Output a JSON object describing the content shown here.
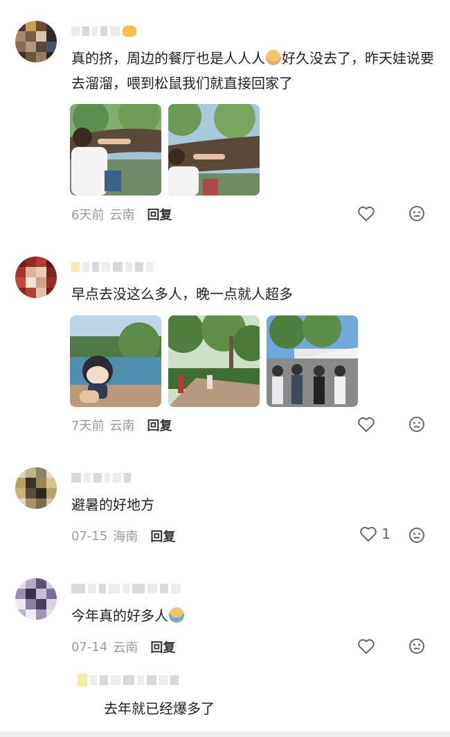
{
  "comments": [
    {
      "text": "真的挤，周边的餐厅也是人人人",
      "text2": "好久没去了，昨天娃说要去溜溜，喂到松鼠我们就直接回家了",
      "time": "6天前",
      "location": "云南",
      "reply": "回复",
      "likes": ""
    },
    {
      "text": "早点去没这么多人，晚一点就人超多",
      "time": "7天前",
      "location": "云南",
      "reply": "回复",
      "likes": ""
    },
    {
      "text": "避暑的好地方",
      "time": "07-15",
      "location": "海南",
      "reply": "回复",
      "likes": "1"
    },
    {
      "text": "今年真的好多人",
      "time": "07-14",
      "location": "云南",
      "reply": "回复",
      "likes": ""
    }
  ],
  "sub_reply": {
    "text": "去年就已经爆多了"
  },
  "icons": {
    "like": "heart-outline-icon",
    "dislike": "neutral-face-icon",
    "emoji1": "cute-face-emoji",
    "emoji2": "sweating-face-emoji"
  },
  "colors": {
    "meta": "#9a9a9a",
    "reply": "#333333",
    "text": "#1f1f1f"
  }
}
